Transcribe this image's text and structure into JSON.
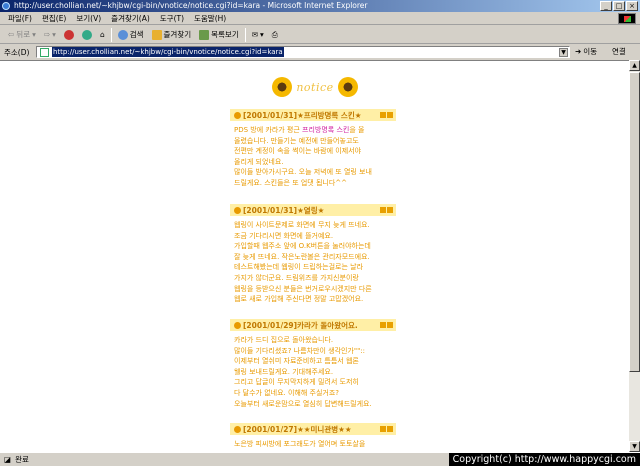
{
  "window": {
    "title": "http://user.chollian.net/~khjbw/cgi-bin/vnotice/notice.cgi?id=kara - Microsoft Internet Explorer"
  },
  "menu": [
    "파일(F)",
    "편집(E)",
    "보기(V)",
    "즐겨찾기(A)",
    "도구(T)",
    "도움말(H)"
  ],
  "toolbar": {
    "back_label": "뒤로",
    "search_label": "검색",
    "favorites_label": "즐겨찾기",
    "history_label": "목록보기"
  },
  "address": {
    "label": "주소(D)",
    "url": "http://user.chollian.net/~khjbw/cgi-bin/vnotice/notice.cgi?id=kara",
    "go_label": "이동",
    "links_label": "연결"
  },
  "logo": {
    "text": "notice"
  },
  "posts": [
    {
      "header": "[2001/01/31]★프리방명록 스킨★",
      "lines": [
        [
          "PDS 방에 카라가 평근 ",
          "프리방명록 스킨",
          "을 올"
        ],
        [
          "올렸습니다. 만들기는 예전에 만들어놓고도",
          "",
          ""
        ],
        [
          "전편만 계정이 속을 썩이는 바람에 이제서야",
          "",
          ""
        ],
        [
          "올리게 되었네요.",
          "",
          ""
        ],
        [
          "많이들 받아가시구요. 오늘 저녁에 또 열링 보내",
          "",
          ""
        ],
        [
          "드릴게요. 스킨들은 또 업댓 됩니다^^",
          "",
          ""
        ]
      ]
    },
    {
      "header": "[2001/01/31]★열링★",
      "lines": [
        [
          "웹링이 사이트문제로 화면에 무지 늦게 뜨네요.",
          "",
          ""
        ],
        [
          "조금 기다리시면 화면에 뜰거예요.",
          "",
          ""
        ],
        [
          "가입할때 웹주소 앞에 O.K버튼을 눌러야하는데",
          "",
          ""
        ],
        [
          "잘 늦게 뜨네요. 작은노란볼은 관리자모드에요.",
          "",
          ""
        ],
        [
          "테스트해봤는데 웹링이 드립하는걸로는 날라",
          "",
          ""
        ],
        [
          "가지가 않더군요. 드림위즈를 가지신분이랑",
          "",
          ""
        ],
        [
          "웹링을 등받으신 분들은 번거로우시겠지만 다른",
          "",
          ""
        ],
        [
          "웹로 새로 가입해 주신다면 정말 고맙겠어요.",
          "",
          ""
        ]
      ]
    },
    {
      "header": "[2001/01/29]카라가 돌아왔어요.",
      "lines": [
        [
          "카라가 드디 집으로 돌아왔습니다.",
          "",
          ""
        ],
        [
          "많이들 기다리셨죠? 나름차만이 생각인가\"\"::",
          "",
          ""
        ],
        [
          "이제부터 열쉬미 자료준비하고 틈틈서 웹론",
          "",
          ""
        ],
        [
          "웰링 보내드릴게요. 기대해주세요.",
          "",
          ""
        ],
        [
          "그리고 답글이 무지막지하게 밀려서 도저히",
          "",
          ""
        ],
        [
          "다 달수가 없네요. 이해해 주실거죠?",
          "",
          ""
        ],
        [
          "오늘부터 새로운맘으로 열심히 답변해드릴게요.",
          "",
          ""
        ]
      ]
    },
    {
      "header": "[2001/01/27]★★미니관병★★",
      "lines": [
        [
          "노은방 피씨방에 포그래도가 열어며 토토살을",
          "",
          ""
        ]
      ]
    }
  ],
  "status": {
    "text": "완료",
    "copyright": "Copyright(c) http://www.happycgi.com"
  },
  "colors": {
    "post_text": "#e89a00",
    "post_header_bg": "#ffefa6",
    "link": "#d020a0",
    "titlebar": "#0a246a"
  }
}
